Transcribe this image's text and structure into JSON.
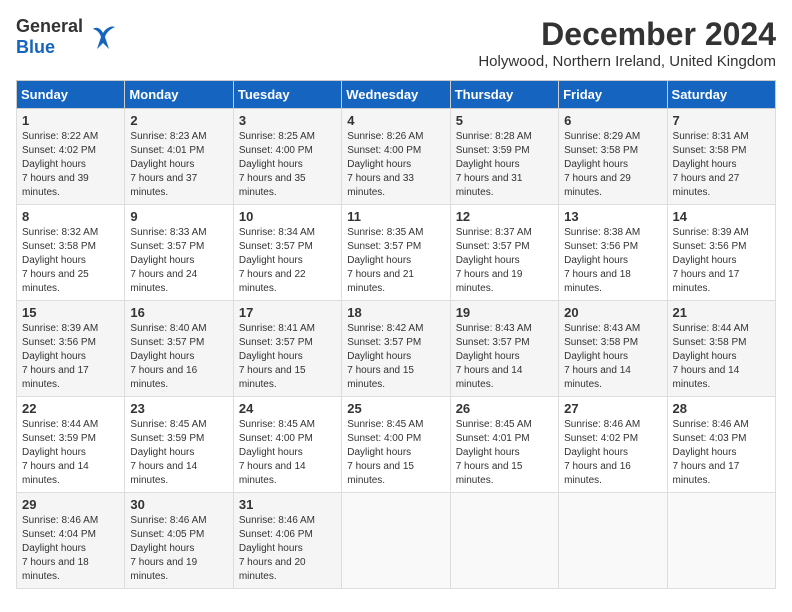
{
  "header": {
    "logo_general": "General",
    "logo_blue": "Blue",
    "month_year": "December 2024",
    "location": "Holywood, Northern Ireland, United Kingdom"
  },
  "days_of_week": [
    "Sunday",
    "Monday",
    "Tuesday",
    "Wednesday",
    "Thursday",
    "Friday",
    "Saturday"
  ],
  "weeks": [
    [
      {
        "day": "1",
        "sunrise": "8:22 AM",
        "sunset": "4:02 PM",
        "daylight": "7 hours and 39 minutes."
      },
      {
        "day": "2",
        "sunrise": "8:23 AM",
        "sunset": "4:01 PM",
        "daylight": "7 hours and 37 minutes."
      },
      {
        "day": "3",
        "sunrise": "8:25 AM",
        "sunset": "4:00 PM",
        "daylight": "7 hours and 35 minutes."
      },
      {
        "day": "4",
        "sunrise": "8:26 AM",
        "sunset": "4:00 PM",
        "daylight": "7 hours and 33 minutes."
      },
      {
        "day": "5",
        "sunrise": "8:28 AM",
        "sunset": "3:59 PM",
        "daylight": "7 hours and 31 minutes."
      },
      {
        "day": "6",
        "sunrise": "8:29 AM",
        "sunset": "3:58 PM",
        "daylight": "7 hours and 29 minutes."
      },
      {
        "day": "7",
        "sunrise": "8:31 AM",
        "sunset": "3:58 PM",
        "daylight": "7 hours and 27 minutes."
      }
    ],
    [
      {
        "day": "8",
        "sunrise": "8:32 AM",
        "sunset": "3:58 PM",
        "daylight": "7 hours and 25 minutes."
      },
      {
        "day": "9",
        "sunrise": "8:33 AM",
        "sunset": "3:57 PM",
        "daylight": "7 hours and 24 minutes."
      },
      {
        "day": "10",
        "sunrise": "8:34 AM",
        "sunset": "3:57 PM",
        "daylight": "7 hours and 22 minutes."
      },
      {
        "day": "11",
        "sunrise": "8:35 AM",
        "sunset": "3:57 PM",
        "daylight": "7 hours and 21 minutes."
      },
      {
        "day": "12",
        "sunrise": "8:37 AM",
        "sunset": "3:57 PM",
        "daylight": "7 hours and 19 minutes."
      },
      {
        "day": "13",
        "sunrise": "8:38 AM",
        "sunset": "3:56 PM",
        "daylight": "7 hours and 18 minutes."
      },
      {
        "day": "14",
        "sunrise": "8:39 AM",
        "sunset": "3:56 PM",
        "daylight": "7 hours and 17 minutes."
      }
    ],
    [
      {
        "day": "15",
        "sunrise": "8:39 AM",
        "sunset": "3:56 PM",
        "daylight": "7 hours and 17 minutes."
      },
      {
        "day": "16",
        "sunrise": "8:40 AM",
        "sunset": "3:57 PM",
        "daylight": "7 hours and 16 minutes."
      },
      {
        "day": "17",
        "sunrise": "8:41 AM",
        "sunset": "3:57 PM",
        "daylight": "7 hours and 15 minutes."
      },
      {
        "day": "18",
        "sunrise": "8:42 AM",
        "sunset": "3:57 PM",
        "daylight": "7 hours and 15 minutes."
      },
      {
        "day": "19",
        "sunrise": "8:43 AM",
        "sunset": "3:57 PM",
        "daylight": "7 hours and 14 minutes."
      },
      {
        "day": "20",
        "sunrise": "8:43 AM",
        "sunset": "3:58 PM",
        "daylight": "7 hours and 14 minutes."
      },
      {
        "day": "21",
        "sunrise": "8:44 AM",
        "sunset": "3:58 PM",
        "daylight": "7 hours and 14 minutes."
      }
    ],
    [
      {
        "day": "22",
        "sunrise": "8:44 AM",
        "sunset": "3:59 PM",
        "daylight": "7 hours and 14 minutes."
      },
      {
        "day": "23",
        "sunrise": "8:45 AM",
        "sunset": "3:59 PM",
        "daylight": "7 hours and 14 minutes."
      },
      {
        "day": "24",
        "sunrise": "8:45 AM",
        "sunset": "4:00 PM",
        "daylight": "7 hours and 14 minutes."
      },
      {
        "day": "25",
        "sunrise": "8:45 AM",
        "sunset": "4:00 PM",
        "daylight": "7 hours and 15 minutes."
      },
      {
        "day": "26",
        "sunrise": "8:45 AM",
        "sunset": "4:01 PM",
        "daylight": "7 hours and 15 minutes."
      },
      {
        "day": "27",
        "sunrise": "8:46 AM",
        "sunset": "4:02 PM",
        "daylight": "7 hours and 16 minutes."
      },
      {
        "day": "28",
        "sunrise": "8:46 AM",
        "sunset": "4:03 PM",
        "daylight": "7 hours and 17 minutes."
      }
    ],
    [
      {
        "day": "29",
        "sunrise": "8:46 AM",
        "sunset": "4:04 PM",
        "daylight": "7 hours and 18 minutes."
      },
      {
        "day": "30",
        "sunrise": "8:46 AM",
        "sunset": "4:05 PM",
        "daylight": "7 hours and 19 minutes."
      },
      {
        "day": "31",
        "sunrise": "8:46 AM",
        "sunset": "4:06 PM",
        "daylight": "7 hours and 20 minutes."
      },
      null,
      null,
      null,
      null
    ]
  ],
  "labels": {
    "sunrise": "Sunrise:",
    "sunset": "Sunset:",
    "daylight": "Daylight hours"
  }
}
